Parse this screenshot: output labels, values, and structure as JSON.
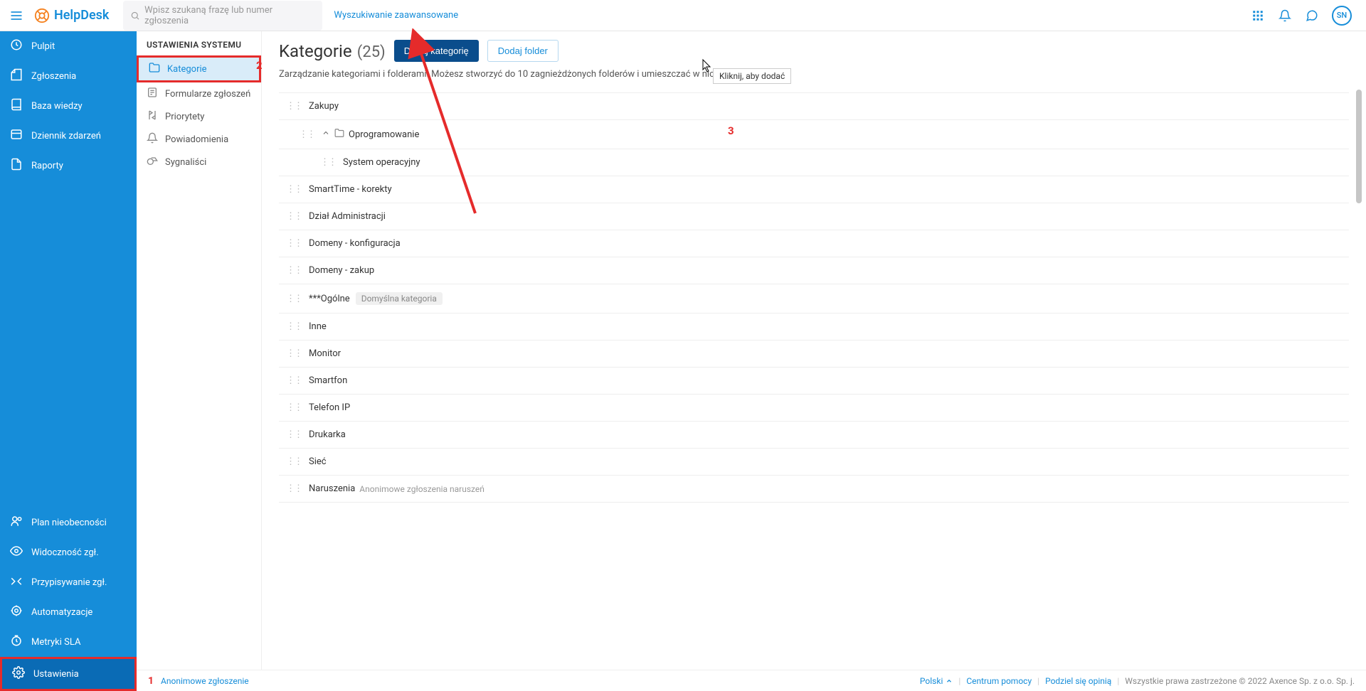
{
  "header": {
    "app_name": "HelpDesk",
    "search_placeholder": "Wpisz szukaną frazę lub numer zgłoszenia",
    "advanced_search": "Wyszukiwanie zaawansowane",
    "avatar_initials": "SN"
  },
  "sidebar": {
    "items_top": [
      {
        "label": "Pulpit",
        "icon": "dashboard"
      },
      {
        "label": "Zgłoszenia",
        "icon": "tickets"
      },
      {
        "label": "Baza wiedzy",
        "icon": "knowledge"
      },
      {
        "label": "Dziennik zdarzeń",
        "icon": "journal"
      },
      {
        "label": "Raporty",
        "icon": "reports"
      }
    ],
    "items_bottom": [
      {
        "label": "Plan nieobecności",
        "icon": "absence"
      },
      {
        "label": "Widoczność zgł.",
        "icon": "visibility"
      },
      {
        "label": "Przypisywanie zgł.",
        "icon": "assign"
      },
      {
        "label": "Automatyzacje",
        "icon": "automation"
      },
      {
        "label": "Metryki SLA",
        "icon": "sla"
      },
      {
        "label": "Ustawienia",
        "icon": "settings",
        "active": true
      }
    ]
  },
  "submenu": {
    "title": "USTAWIENIA SYSTEMU",
    "items": [
      {
        "label": "Kategorie",
        "icon": "folder",
        "active": true,
        "highlighted": true
      },
      {
        "label": "Formularze zgłoszeń",
        "icon": "form"
      },
      {
        "label": "Priorytety",
        "icon": "priority"
      },
      {
        "label": "Powiadomienia",
        "icon": "bell"
      },
      {
        "label": "Sygnaliści",
        "icon": "whistle"
      }
    ]
  },
  "page": {
    "title": "Kategorie",
    "count": "(25)",
    "btn_add_cat": "Dodaj kategorię",
    "btn_add_folder": "Dodaj folder",
    "description": "Zarządzanie kategoriami i folderami. Możesz stworzyć do 10 zagnieżdżonych folderów i umieszczać w nich kategorie.",
    "tooltip": "Kliknij, aby dodać"
  },
  "categories": [
    {
      "label": "Zakupy"
    },
    {
      "label": "Oprogramowanie",
      "folder": true,
      "expanded": true
    },
    {
      "label": "System operacyjny",
      "indent": 2
    },
    {
      "label": "SmartTime - korekty"
    },
    {
      "label": "Dział Administracji"
    },
    {
      "label": "Domeny - konfiguracja"
    },
    {
      "label": "Domeny - zakup"
    },
    {
      "label": "***Ogólne",
      "badge": "Domyślna kategoria"
    },
    {
      "label": "Inne"
    },
    {
      "label": "Monitor"
    },
    {
      "label": "Smartfon"
    },
    {
      "label": "Telefon IP"
    },
    {
      "label": "Drukarka"
    },
    {
      "label": "Sieć"
    },
    {
      "label": "Naruszenia",
      "subtext": "Anonimowe zgłoszenia naruszeń"
    }
  ],
  "annotations": {
    "n1": "1",
    "n2": "2",
    "n3": "3",
    "anon_link": "Anonimowe zgłoszenie"
  },
  "footer": {
    "lang": "Polski",
    "help": "Centrum pomocy",
    "feedback": "Podziel się opinią",
    "copyright": "Wszystkie prawa zastrzeżone © 2022 Axence Sp. z o.o. Sp. j."
  }
}
